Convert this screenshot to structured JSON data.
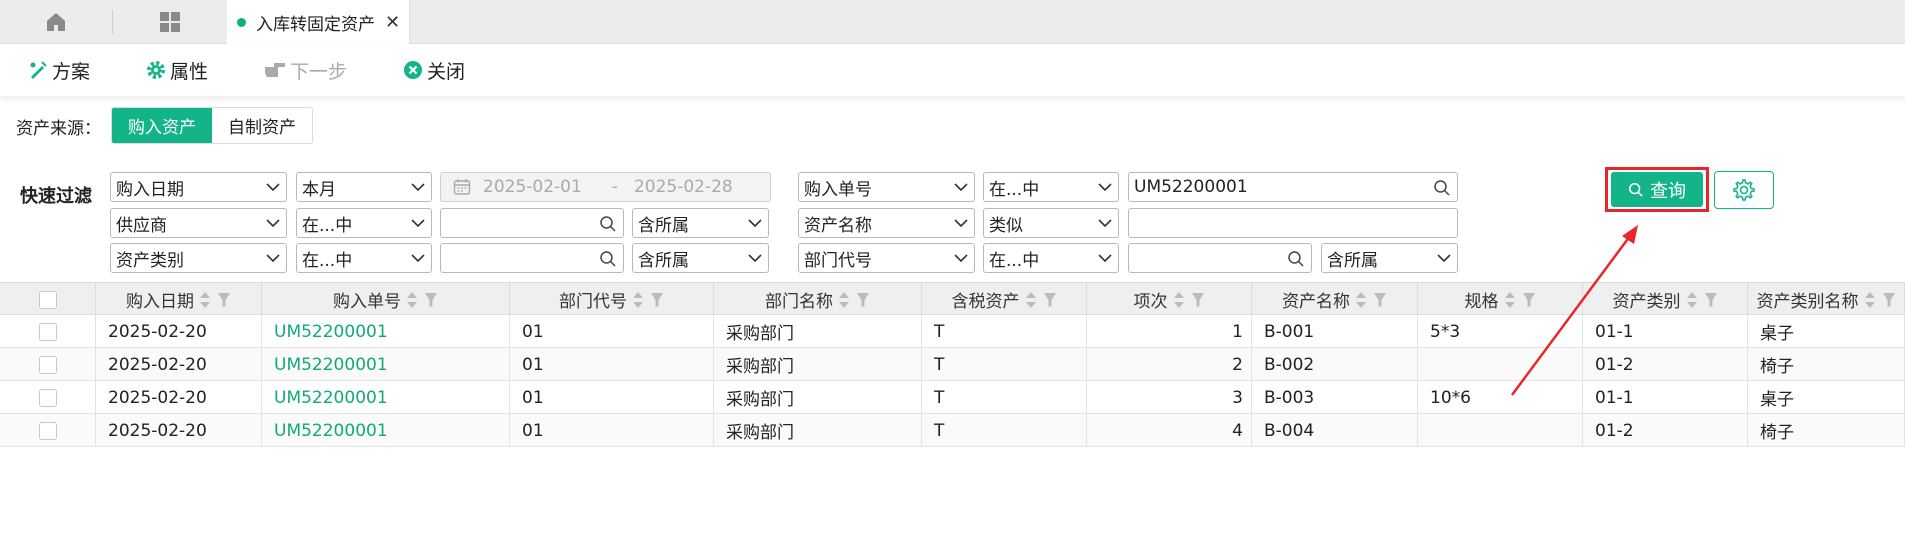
{
  "tabs": {
    "active_label": "入库转固定资产",
    "close_glyph": "✕"
  },
  "toolbar": {
    "scheme": "方案",
    "properties": "属性",
    "next_step": "下一步",
    "close": "关闭"
  },
  "asset_source": {
    "label": "资产来源：",
    "options": [
      "购入资产",
      "自制资产"
    ],
    "selected": "购入资产"
  },
  "quick_filter": {
    "label": "快速过滤",
    "rows": [
      {
        "field1": "购入日期",
        "op1": "本月",
        "date_start": "2025-02-01",
        "date_sep": "-",
        "date_end": "2025-02-28",
        "field2": "购入单号",
        "op2": "在...中",
        "value2": "UM52200001"
      },
      {
        "field1": "供应商",
        "op1": "在...中",
        "value1": "",
        "scope1": "含所属",
        "field2": "资产名称",
        "op2": "类似",
        "value2": ""
      },
      {
        "field1": "资产类别",
        "op1": "在...中",
        "value1": "",
        "scope1": "含所属",
        "field2": "部门代号",
        "op2": "在...中",
        "value2": "",
        "scope2": "含所属"
      }
    ],
    "query_label": "查询"
  },
  "table": {
    "columns": [
      "购入日期",
      "购入单号",
      "部门代号",
      "部门名称",
      "含税资产",
      "项次",
      "资产名称",
      "规格",
      "资产类别",
      "资产类别名称"
    ],
    "rows": [
      [
        "2025-02-20",
        "UM52200001",
        "01",
        "采购部门",
        "T",
        "1",
        "B-001",
        "5*3",
        "01-1",
        "桌子"
      ],
      [
        "2025-02-20",
        "UM52200001",
        "01",
        "采购部门",
        "T",
        "2",
        "B-002",
        "",
        "01-2",
        "椅子"
      ],
      [
        "2025-02-20",
        "UM52200001",
        "01",
        "采购部门",
        "T",
        "3",
        "B-003",
        "10*6",
        "01-1",
        "桌子"
      ],
      [
        "2025-02-20",
        "UM52200001",
        "01",
        "采购部门",
        "T",
        "4",
        "B-004",
        "",
        "01-2",
        "椅子"
      ]
    ]
  },
  "colors": {
    "accent": "#14b48a",
    "highlight": "#e8262a",
    "link": "#11a979"
  },
  "icons": [
    "home-icon",
    "grid-icon",
    "scheme-icon",
    "gear-icon",
    "pointing-hand-icon",
    "close-circle-icon",
    "calendar-icon",
    "search-icon",
    "chevron-down-icon",
    "sort-icon",
    "filter-icon",
    "settings-icon",
    "red-arrow"
  ]
}
